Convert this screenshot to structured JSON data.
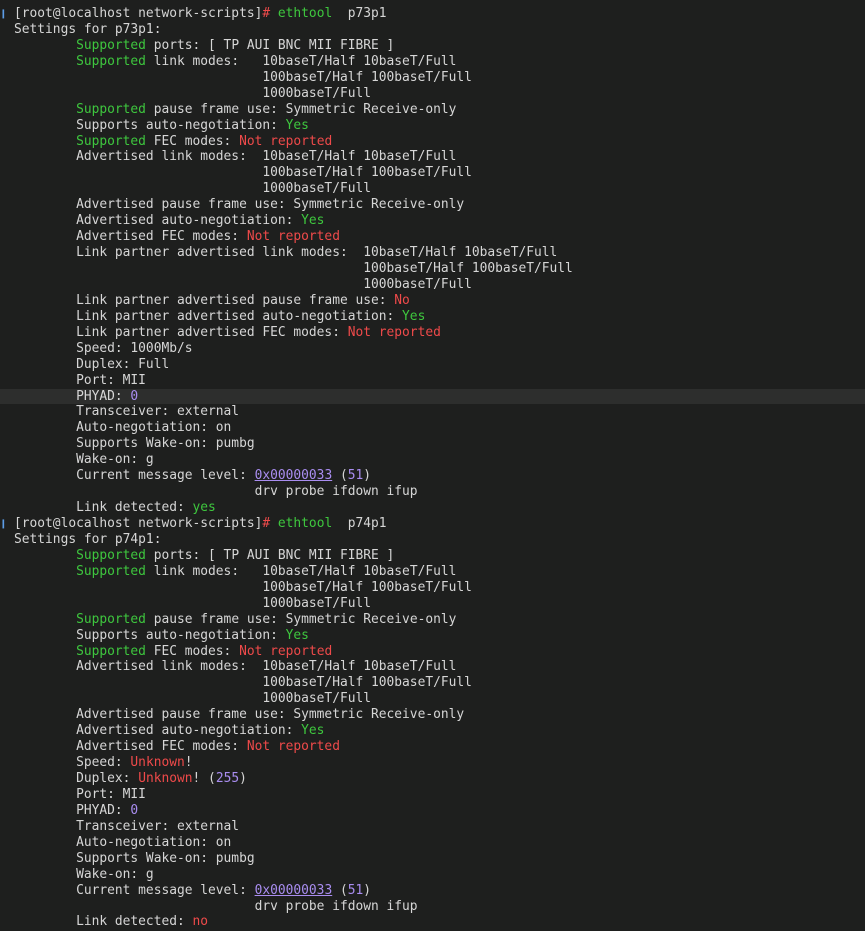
{
  "colors": {
    "background": "#1e1f1e",
    "text": "#d6d6d6",
    "green": "#3ec73e",
    "red": "#ef4a4a",
    "purple": "#a98df0",
    "prompt_marker": "#5c9ce6",
    "highlight_row": "#2d2e2d"
  },
  "lines": [
    {
      "marker": true,
      "segs": [
        {
          "t": "[root@localhost network-scripts]"
        },
        {
          "t": "# ",
          "c": "red"
        },
        {
          "t": "ethtool",
          "c": "green"
        },
        {
          "t": "  p73p1"
        }
      ]
    },
    {
      "segs": [
        {
          "t": "Settings for p73p1:"
        }
      ]
    },
    {
      "segs": [
        {
          "t": "        "
        },
        {
          "t": "Supported",
          "c": "green"
        },
        {
          "t": " ports: [ TP AUI BNC MII FIBRE ]"
        }
      ]
    },
    {
      "segs": [
        {
          "t": "        "
        },
        {
          "t": "Supported",
          "c": "green"
        },
        {
          "t": " link modes:   10baseT/Half 10baseT/Full"
        }
      ]
    },
    {
      "segs": [
        {
          "t": "                                100baseT/Half 100baseT/Full"
        }
      ]
    },
    {
      "segs": [
        {
          "t": "                                1000baseT/Full"
        }
      ]
    },
    {
      "segs": [
        {
          "t": "        "
        },
        {
          "t": "Supported",
          "c": "green"
        },
        {
          "t": " pause frame use: Symmetric Receive-only"
        }
      ]
    },
    {
      "segs": [
        {
          "t": "        Supports auto-negotiation: "
        },
        {
          "t": "Yes",
          "c": "green"
        }
      ]
    },
    {
      "segs": [
        {
          "t": "        "
        },
        {
          "t": "Supported",
          "c": "green"
        },
        {
          "t": " FEC modes: "
        },
        {
          "t": "Not reported",
          "c": "red"
        }
      ]
    },
    {
      "segs": [
        {
          "t": "        Advertised link modes:  10baseT/Half 10baseT/Full"
        }
      ]
    },
    {
      "segs": [
        {
          "t": "                                100baseT/Half 100baseT/Full"
        }
      ]
    },
    {
      "segs": [
        {
          "t": "                                1000baseT/Full"
        }
      ]
    },
    {
      "segs": [
        {
          "t": "        Advertised pause frame use: Symmetric Receive-only"
        }
      ]
    },
    {
      "segs": [
        {
          "t": "        Advertised auto-negotiation: "
        },
        {
          "t": "Yes",
          "c": "green"
        }
      ]
    },
    {
      "segs": [
        {
          "t": "        Advertised FEC modes: "
        },
        {
          "t": "Not reported",
          "c": "red"
        }
      ]
    },
    {
      "segs": [
        {
          "t": "        Link partner advertised link modes:  10baseT/Half 10baseT/Full"
        }
      ]
    },
    {
      "segs": [
        {
          "t": "                                             100baseT/Half 100baseT/Full"
        }
      ]
    },
    {
      "segs": [
        {
          "t": "                                             1000baseT/Full"
        }
      ]
    },
    {
      "segs": [
        {
          "t": "        Link partner advertised pause frame use: "
        },
        {
          "t": "No",
          "c": "red"
        }
      ]
    },
    {
      "segs": [
        {
          "t": "        Link partner advertised auto-negotiation: "
        },
        {
          "t": "Yes",
          "c": "green"
        }
      ]
    },
    {
      "segs": [
        {
          "t": "        Link partner advertised FEC modes: "
        },
        {
          "t": "Not reported",
          "c": "red"
        }
      ]
    },
    {
      "segs": [
        {
          "t": "        Speed: 1000Mb/s"
        }
      ]
    },
    {
      "segs": [
        {
          "t": "        Duplex: Full"
        }
      ]
    },
    {
      "segs": [
        {
          "t": "        Port: MII"
        }
      ]
    },
    {
      "hl": true,
      "segs": [
        {
          "t": "        PHYAD: "
        },
        {
          "t": "0",
          "c": "purple"
        }
      ]
    },
    {
      "segs": [
        {
          "t": "        Transceiver: external"
        }
      ]
    },
    {
      "segs": [
        {
          "t": "        Auto-negotiation: on"
        }
      ]
    },
    {
      "segs": [
        {
          "t": "        Supports Wake-on: pumbg"
        }
      ]
    },
    {
      "segs": [
        {
          "t": "        Wake-on: g"
        }
      ]
    },
    {
      "segs": [
        {
          "t": "        Current message level: "
        },
        {
          "t": "0x00000033",
          "c": "link"
        },
        {
          "t": " ("
        },
        {
          "t": "51",
          "c": "purple"
        },
        {
          "t": ")"
        }
      ]
    },
    {
      "segs": [
        {
          "t": "                               drv probe ifdown ifup"
        }
      ]
    },
    {
      "segs": [
        {
          "t": "        Link detected: "
        },
        {
          "t": "yes",
          "c": "green"
        }
      ]
    },
    {
      "marker": true,
      "segs": [
        {
          "t": "[root@localhost network-scripts]"
        },
        {
          "t": "# ",
          "c": "red"
        },
        {
          "t": "ethtool",
          "c": "green"
        },
        {
          "t": "  p74p1"
        }
      ]
    },
    {
      "segs": [
        {
          "t": "Settings for p74p1:"
        }
      ]
    },
    {
      "segs": [
        {
          "t": "        "
        },
        {
          "t": "Supported",
          "c": "green"
        },
        {
          "t": " ports: [ TP AUI BNC MII FIBRE ]"
        }
      ]
    },
    {
      "segs": [
        {
          "t": "        "
        },
        {
          "t": "Supported",
          "c": "green"
        },
        {
          "t": " link modes:   10baseT/Half 10baseT/Full"
        }
      ]
    },
    {
      "segs": [
        {
          "t": "                                100baseT/Half 100baseT/Full"
        }
      ]
    },
    {
      "segs": [
        {
          "t": "                                1000baseT/Full"
        }
      ]
    },
    {
      "segs": [
        {
          "t": "        "
        },
        {
          "t": "Supported",
          "c": "green"
        },
        {
          "t": " pause frame use: Symmetric Receive-only"
        }
      ]
    },
    {
      "segs": [
        {
          "t": "        Supports auto-negotiation: "
        },
        {
          "t": "Yes",
          "c": "green"
        }
      ]
    },
    {
      "segs": [
        {
          "t": "        "
        },
        {
          "t": "Supported",
          "c": "green"
        },
        {
          "t": " FEC modes: "
        },
        {
          "t": "Not reported",
          "c": "red"
        }
      ]
    },
    {
      "segs": [
        {
          "t": "        Advertised link modes:  10baseT/Half 10baseT/Full"
        }
      ]
    },
    {
      "segs": [
        {
          "t": "                                100baseT/Half 100baseT/Full"
        }
      ]
    },
    {
      "segs": [
        {
          "t": "                                1000baseT/Full"
        }
      ]
    },
    {
      "segs": [
        {
          "t": "        Advertised pause frame use: Symmetric Receive-only"
        }
      ]
    },
    {
      "segs": [
        {
          "t": "        Advertised auto-negotiation: "
        },
        {
          "t": "Yes",
          "c": "green"
        }
      ]
    },
    {
      "segs": [
        {
          "t": "        Advertised FEC modes: "
        },
        {
          "t": "Not reported",
          "c": "red"
        }
      ]
    },
    {
      "segs": [
        {
          "t": "        Speed: "
        },
        {
          "t": "Unknown",
          "c": "red"
        },
        {
          "t": "!"
        }
      ]
    },
    {
      "segs": [
        {
          "t": "        Duplex: "
        },
        {
          "t": "Unknown",
          "c": "red"
        },
        {
          "t": "! ("
        },
        {
          "t": "255",
          "c": "purple"
        },
        {
          "t": ")"
        }
      ]
    },
    {
      "segs": [
        {
          "t": "        Port: MII"
        }
      ]
    },
    {
      "segs": [
        {
          "t": "        PHYAD: "
        },
        {
          "t": "0",
          "c": "purple"
        }
      ]
    },
    {
      "segs": [
        {
          "t": "        Transceiver: external"
        }
      ]
    },
    {
      "segs": [
        {
          "t": "        Auto-negotiation: on"
        }
      ]
    },
    {
      "segs": [
        {
          "t": "        Supports Wake-on: pumbg"
        }
      ]
    },
    {
      "segs": [
        {
          "t": "        Wake-on: g"
        }
      ]
    },
    {
      "segs": [
        {
          "t": "        Current message level: "
        },
        {
          "t": "0x00000033",
          "c": "link"
        },
        {
          "t": " ("
        },
        {
          "t": "51",
          "c": "purple"
        },
        {
          "t": ")"
        }
      ]
    },
    {
      "segs": [
        {
          "t": "                               drv probe ifdown ifup"
        }
      ]
    },
    {
      "segs": [
        {
          "t": "        Link detected: "
        },
        {
          "t": "no",
          "c": "red"
        }
      ]
    }
  ]
}
